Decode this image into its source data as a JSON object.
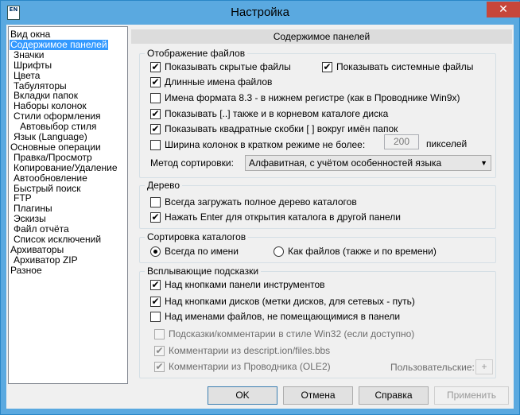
{
  "window": {
    "title": "Настройка",
    "icon_text": "EN",
    "close_glyph": "✕"
  },
  "tree": {
    "items": [
      {
        "label": "Вид окна",
        "level": 0
      },
      {
        "label": "Содержимое панелей",
        "level": 0,
        "selected": true
      },
      {
        "label": "Значки",
        "level": 1
      },
      {
        "label": "Шрифты",
        "level": 1
      },
      {
        "label": "Цвета",
        "level": 1
      },
      {
        "label": "Табуляторы",
        "level": 1
      },
      {
        "label": "Вкладки папок",
        "level": 1
      },
      {
        "label": "Наборы колонок",
        "level": 1
      },
      {
        "label": "Стили оформления",
        "level": 1
      },
      {
        "label": "Автовыбор стиля",
        "level": 2
      },
      {
        "label": "Язык (Language)",
        "level": 1
      },
      {
        "label": "Основные операции",
        "level": 0
      },
      {
        "label": "Правка/Просмотр",
        "level": 1
      },
      {
        "label": "Копирование/Удаление",
        "level": 1
      },
      {
        "label": "Автообновление",
        "level": 1
      },
      {
        "label": "Быстрый поиск",
        "level": 1
      },
      {
        "label": "FTP",
        "level": 1
      },
      {
        "label": "Плагины",
        "level": 1
      },
      {
        "label": "Эскизы",
        "level": 1
      },
      {
        "label": "Файл отчёта",
        "level": 1
      },
      {
        "label": "Список исключений",
        "level": 1
      },
      {
        "label": "Архиваторы",
        "level": 0
      },
      {
        "label": "Архиватор ZIP",
        "level": 1
      },
      {
        "label": "Разное",
        "level": 0
      }
    ]
  },
  "panel_header": "Содержимое панелей",
  "file_display": {
    "title": "Отображение файлов",
    "show_hidden": {
      "label": "Показывать скрытые файлы",
      "checked": true
    },
    "show_system": {
      "label": "Показывать системные файлы",
      "checked": true
    },
    "long_names": {
      "label": "Длинные имена файлов",
      "checked": true
    },
    "lowercase_83": {
      "label": "Имена формата 8.3 - в нижнем регистре (как в Проводнике Win9x)",
      "checked": false
    },
    "show_updir_root": {
      "label": "Показывать [..] также и в корневом каталоге диска",
      "checked": true
    },
    "square_brackets": {
      "label": "Показывать квадратные скобки [ ] вокруг имён папок",
      "checked": true
    },
    "column_width": {
      "label": "Ширина колонок в кратком режиме не более:",
      "checked": false,
      "value": "200",
      "unit": "пикселей"
    },
    "sort_method": {
      "label": "Метод сортировки:",
      "value": "Алфавитная, с учётом особенностей языка"
    }
  },
  "tree_group": {
    "title": "Дерево",
    "load_full_tree": {
      "label": "Всегда загружать полное дерево каталогов",
      "checked": false
    },
    "enter_other_panel": {
      "label": "Нажать Enter для открытия каталога в другой панели",
      "checked": true
    }
  },
  "dir_sort": {
    "title": "Сортировка каталогов",
    "by_name": {
      "label": "Всегда по имени",
      "selected": true
    },
    "like_files": {
      "label": "Как файлов (также и по времени)",
      "selected": false
    }
  },
  "tooltips": {
    "title": "Всплывающие подсказки",
    "toolbar": {
      "label": "Над кнопками панели инструментов",
      "checked": true
    },
    "drive_buttons": {
      "label": "Над кнопками дисков (метки дисков, для сетевых - путь)",
      "checked": true
    },
    "long_names": {
      "label": "Над именами файлов, не помещающимися в панели",
      "checked": false
    },
    "win32_style": {
      "label": "Подсказки/комментарии в стиле Win32 (если доступно)",
      "checked": false
    },
    "descript_ion": {
      "label": "Комментарии из descript.ion/files.bbs",
      "checked": true
    },
    "explorer_comments": {
      "label": "Комментарии из Проводника (OLE2)",
      "checked": true
    },
    "custom_label": "Пользовательские:",
    "custom_button": "+"
  },
  "buttons": {
    "ok": "OK",
    "cancel": "Отмена",
    "help": "Справка",
    "apply": "Применить"
  },
  "check_glyph": "✔",
  "arrow_glyph": "▼"
}
